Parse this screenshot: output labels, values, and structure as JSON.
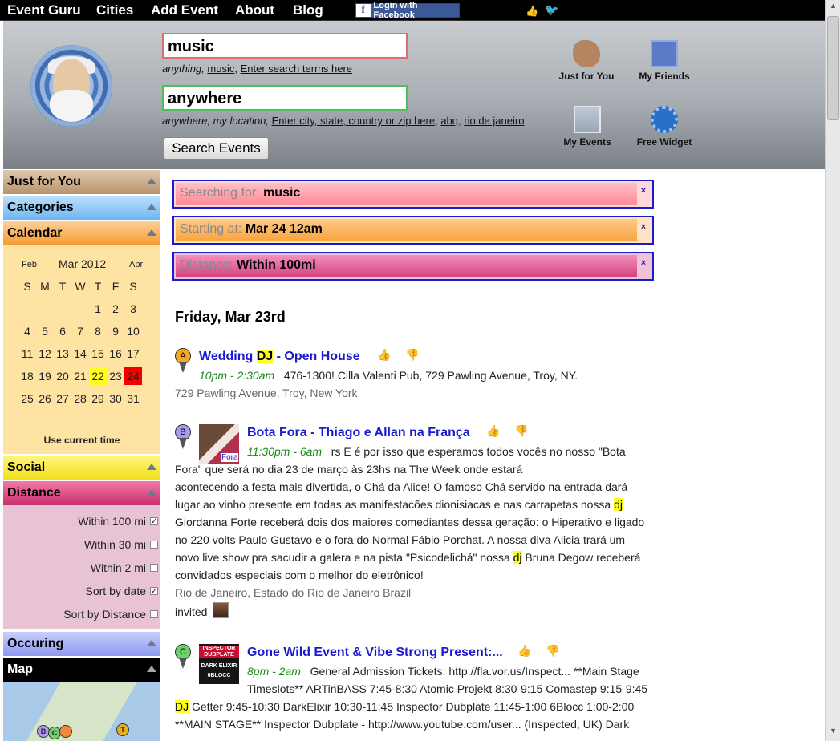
{
  "nav": {
    "brand": "Event Guru",
    "items": [
      "Cities",
      "Add Event",
      "About",
      "Blog"
    ],
    "fb_login": "Login with Facebook"
  },
  "header": {
    "what_value": "music",
    "what_hint_italic": "anything,",
    "what_hint_link1": "music",
    "what_hint_link2": "Enter search terms here",
    "where_value": "anywhere",
    "where_hint_italic": "anywhere, my location,",
    "where_hint_link1": "Enter city, state, country or zip here",
    "where_hint_link2": "abq",
    "where_hint_link3": "rio de janeiro",
    "search_button": "Search Events",
    "links": {
      "just_for_you": "Just for You",
      "my_friends": "My Friends",
      "my_events": "My Events",
      "free_widget": "Free Widget"
    }
  },
  "sidebar": {
    "just_for_you": "Just for You",
    "categories": "Categories",
    "calendar": "Calendar",
    "calendar_body": {
      "prev_month": "Feb",
      "month": "Mar 2012",
      "next_month": "Apr",
      "weekdays": [
        "S",
        "M",
        "T",
        "W",
        "T",
        "F",
        "S"
      ],
      "weeks": [
        [
          "",
          "",
          "",
          "",
          "1",
          "2",
          "3"
        ],
        [
          "4",
          "5",
          "6",
          "7",
          "8",
          "9",
          "10"
        ],
        [
          "11",
          "12",
          "13",
          "14",
          "15",
          "16",
          "17"
        ],
        [
          "18",
          "19",
          "20",
          "21",
          "22",
          "23",
          "24"
        ],
        [
          "25",
          "26",
          "27",
          "28",
          "29",
          "30",
          "31"
        ]
      ],
      "today": "22",
      "selected": "24",
      "use_current": "Use current time"
    },
    "social": "Social",
    "distance": "Distance",
    "distance_options": [
      {
        "label": "Within 100 mi",
        "checked": true
      },
      {
        "label": "Within 30 mi",
        "checked": false
      },
      {
        "label": "Within 2 mi",
        "checked": false
      },
      {
        "label": "Sort by date",
        "checked": true
      },
      {
        "label": "Sort by Distance",
        "checked": false
      }
    ],
    "occuring": "Occuring",
    "map": "Map",
    "map_markers": [
      "B",
      "C",
      "T"
    ]
  },
  "filters": [
    {
      "label": "Searching for:",
      "value": "music",
      "close": "×"
    },
    {
      "label": "Starting at:",
      "value": "Mar 24 12am",
      "close": "×"
    },
    {
      "label": "Distance:",
      "value": "Within 100mi",
      "close": "×"
    }
  ],
  "results": {
    "day_heading": "Friday, Mar 23rd",
    "events": [
      {
        "marker": "A",
        "title_pre": "Wedding ",
        "title_hl": "DJ",
        "title_post": " - Open House",
        "time": "10pm - 2:30am",
        "desc": "476-1300! Cilla Valenti Pub, 729 Pawling Avenue, Troy, NY.",
        "location": "729 Pawling Avenue, Troy, New York"
      },
      {
        "marker": "B",
        "title": "Bota Fora - Thiago e Allan na França",
        "time": "11:30pm - 6am",
        "desc_lines": [
          "rs E é por isso que esperamos todos vocês no nosso \"Bota",
          "Fora\" que será no dia 23 de março às 23hs na The Week onde estará",
          "acontecendo a festa mais divertida, o Chá da Alice! O famoso Chá servido na entrada dará",
          "lugar ao vinho presente em todas as manifestacões dionisiacas e nas carrapetas nossa ",
          "Giordanna Forte receberá dois dos maiores comediantes dessa geração: o Hiperativo e ligado",
          "no 220 volts Paulo Gustavo e o fora do Normal Fábio Porchat. A nossa diva Alicia trará um",
          "novo live show pra sacudir a galera e na pista \"Psicodelichá\" nossa ",
          "convidados especiais com o melhor do eletrônico!"
        ],
        "desc_hl": "dj",
        "desc_line8_post": " Bruna Degow receberá",
        "location": "Rio de Janeiro, Estado do Rio de Janeiro Brazil",
        "invited": "invited",
        "thumb_text": "Fora"
      },
      {
        "marker": "C",
        "title": "Gone Wild Event & Vibe Strong Present:...",
        "time": "8pm - 2am",
        "desc_lines": [
          "General Admission Tickets: http://fla.vor.us/Inspect... **Main Stage",
          "Timeslots** ARTinBASS 7:45-8:30 Atomic Projekt 8:30-9:15 Comastep 9:15-9:45",
          " Getter 9:45-10:30 DarkElixir 10:30-11:45 Inspector Dubplate 11:45-1:00 6Blocc 1:00-2:00",
          "**MAIN STAGE** Inspector Dubplate - http://www.youtube.com/user... (Inspected, UK) Dark"
        ],
        "desc_hl": "DJ",
        "thumb_lines": [
          "INSPECTOR",
          "DUBPLATE",
          "DARK ELIXIR",
          "6BLOCC"
        ]
      }
    ]
  },
  "colors": {
    "link_blue": "#1a1ad0",
    "time_green": "#1a8a1a",
    "highlight": "#ffff20",
    "selected_day": "#f00000"
  }
}
